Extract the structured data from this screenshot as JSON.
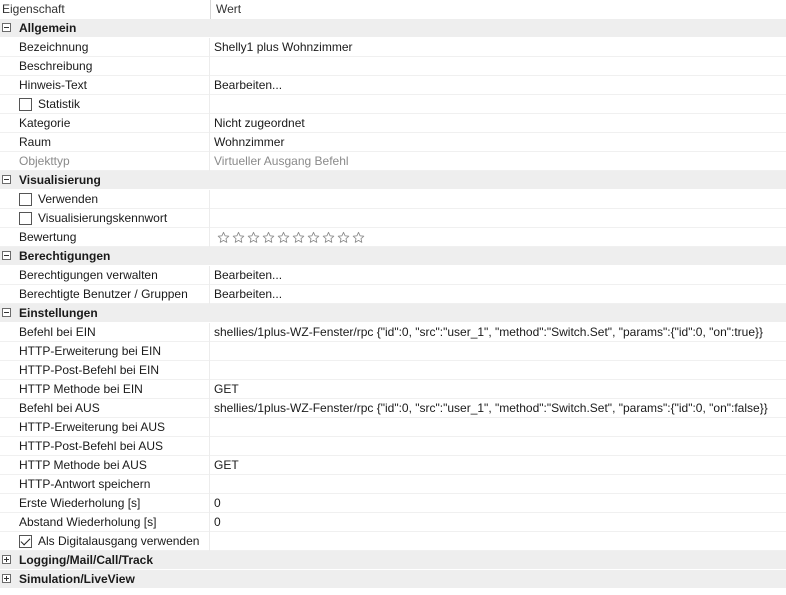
{
  "header": {
    "col_property": "Eigenschaft",
    "col_value": "Wert"
  },
  "sections": {
    "allgemein": {
      "title": "Allgemein",
      "bezeichnung": {
        "label": "Bezeichnung",
        "value": "Shelly1 plus Wohnzimmer"
      },
      "beschreibung": {
        "label": "Beschreibung",
        "value": ""
      },
      "hinweis": {
        "label": "Hinweis-Text",
        "value": "Bearbeiten..."
      },
      "statistik": {
        "label": "Statistik",
        "checked": false
      },
      "kategorie": {
        "label": "Kategorie",
        "value": "Nicht zugeordnet"
      },
      "raum": {
        "label": "Raum",
        "value": "Wohnzimmer"
      },
      "objekttyp": {
        "label": "Objekttyp",
        "value": "Virtueller Ausgang Befehl"
      }
    },
    "visualisierung": {
      "title": "Visualisierung",
      "verwenden": {
        "label": "Verwenden",
        "checked": false
      },
      "kennwort": {
        "label": "Visualisierungskennwort",
        "checked": false
      },
      "bewertung": {
        "label": "Bewertung",
        "stars_total": 10,
        "stars_filled": 0
      }
    },
    "berechtigungen": {
      "title": "Berechtigungen",
      "verwalten": {
        "label": "Berechtigungen verwalten",
        "value": "Bearbeiten..."
      },
      "benutzer": {
        "label": "Berechtigte Benutzer / Gruppen",
        "value": "Bearbeiten..."
      }
    },
    "einstellungen": {
      "title": "Einstellungen",
      "befehl_ein": {
        "label": "Befehl bei EIN",
        "value": "shellies/1plus-WZ-Fenster/rpc {\"id\":0, \"src\":\"user_1\", \"method\":\"Switch.Set\", \"params\":{\"id\":0, \"on\":true}}"
      },
      "http_erw_ein": {
        "label": "HTTP-Erweiterung bei EIN",
        "value": ""
      },
      "http_post_ein": {
        "label": "HTTP-Post-Befehl bei EIN",
        "value": ""
      },
      "http_meth_ein": {
        "label": "HTTP Methode bei EIN",
        "value": "GET"
      },
      "befehl_aus": {
        "label": "Befehl bei AUS",
        "value": "shellies/1plus-WZ-Fenster/rpc {\"id\":0, \"src\":\"user_1\", \"method\":\"Switch.Set\", \"params\":{\"id\":0, \"on\":false}}"
      },
      "http_erw_aus": {
        "label": "HTTP-Erweiterung bei AUS",
        "value": ""
      },
      "http_post_aus": {
        "label": "HTTP-Post-Befehl bei AUS",
        "value": ""
      },
      "http_meth_aus": {
        "label": "HTTP Methode bei AUS",
        "value": "GET"
      },
      "http_antwort": {
        "label": "HTTP-Antwort speichern",
        "value": ""
      },
      "erste_wdh": {
        "label": "Erste Wiederholung [s]",
        "value": "0"
      },
      "abstand_wdh": {
        "label": "Abstand Wiederholung [s]",
        "value": "0"
      },
      "digitalausgang": {
        "label": "Als Digitalausgang verwenden",
        "checked": true
      }
    },
    "logging": {
      "title": "Logging/Mail/Call/Track"
    },
    "simulation": {
      "title": "Simulation/LiveView"
    }
  },
  "colors": {
    "category_bg": "#eeeeee",
    "disabled_text": "#8a8a8a",
    "star_stroke": "#8c8c8c"
  }
}
